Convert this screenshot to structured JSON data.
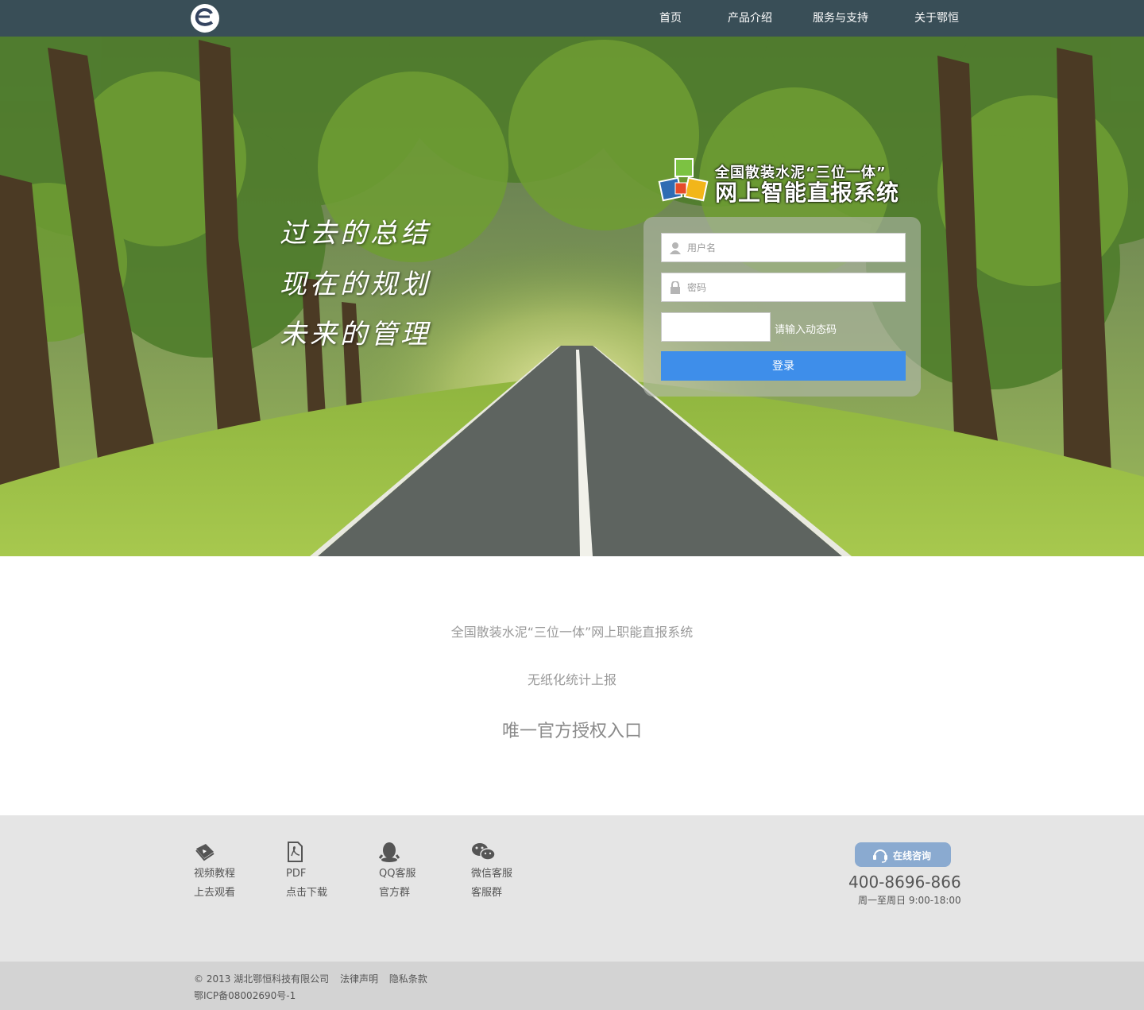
{
  "nav": {
    "logo_icon": "e-logo-icon",
    "items": [
      {
        "label": "首页"
      },
      {
        "label": "产品介绍"
      },
      {
        "label": "服务与支持"
      },
      {
        "label": "关于鄂恒"
      }
    ]
  },
  "hero": {
    "slogan": [
      "过去的总结",
      "现在的规划",
      "未来的管理"
    ],
    "system_logo": {
      "line1": "全国散装水泥“三位一体”",
      "line2": "网上智能直报系统"
    }
  },
  "login": {
    "username_placeholder": "用户名",
    "password_placeholder": "密码",
    "code_hint": "请输入动态码",
    "submit_label": "登录",
    "accent_color": "#3e8eea"
  },
  "intro": {
    "line1": "全国散装水泥“三位一体”网上职能直报系统",
    "line2": "无纸化统计上报",
    "line3": "唯一官方授权入口"
  },
  "footer": {
    "links": [
      {
        "icon": "video-book-icon",
        "title": "视频教程",
        "sub": "上去观看"
      },
      {
        "icon": "pdf-icon",
        "title": "PDF",
        "sub": "点击下载"
      },
      {
        "icon": "qq-icon",
        "title": "QQ客服",
        "sub": "官方群"
      },
      {
        "icon": "wechat-icon",
        "title": "微信客服",
        "sub": "客服群"
      }
    ],
    "consult_label": "在线咨询",
    "phone": "400-8696-866",
    "hours": "周一至周日 9:00-18:00"
  },
  "bottom": {
    "copyright": "© 2013 湖北鄂恒科技有限公司",
    "legal": "法律声明",
    "privacy": "隐私条款",
    "icp": "鄂ICP备08002690号-1"
  }
}
